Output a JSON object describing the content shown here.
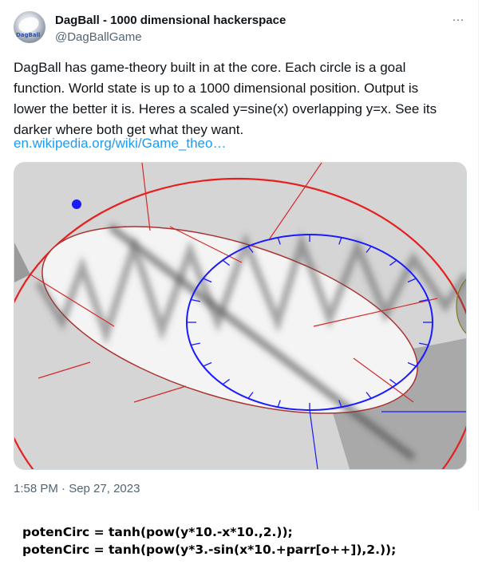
{
  "tweet": {
    "display_name": "DagBall - 1000 dimensional hackerspace",
    "handle": "@DagBallGame",
    "avatar_label": "DagBall",
    "more_label": "···",
    "text": "DagBall has game-theory built in at the core. Each circle is a goal function. World state is up to a 1000 dimensional position. Output is lower the better it is. Heres a scaled y=sine(x) overlapping y=x. See its darker where both get what they want.",
    "link": "en.wikipedia.org/wiki/Game_theo…",
    "timestamp": "1:58 PM · Sep 27, 2023"
  },
  "colors": {
    "link": "#1d9bf0",
    "secondary_text": "#536471",
    "blue_circle": "#1a1aff",
    "red_circle": "#e02020"
  },
  "code": {
    "line1": "potenCirc = tanh(pow(y*10.-x*10.,2.));",
    "line2": "potenCirc = tanh(pow(y*3.-sin(x*10.+parr[o++]),2.));"
  }
}
